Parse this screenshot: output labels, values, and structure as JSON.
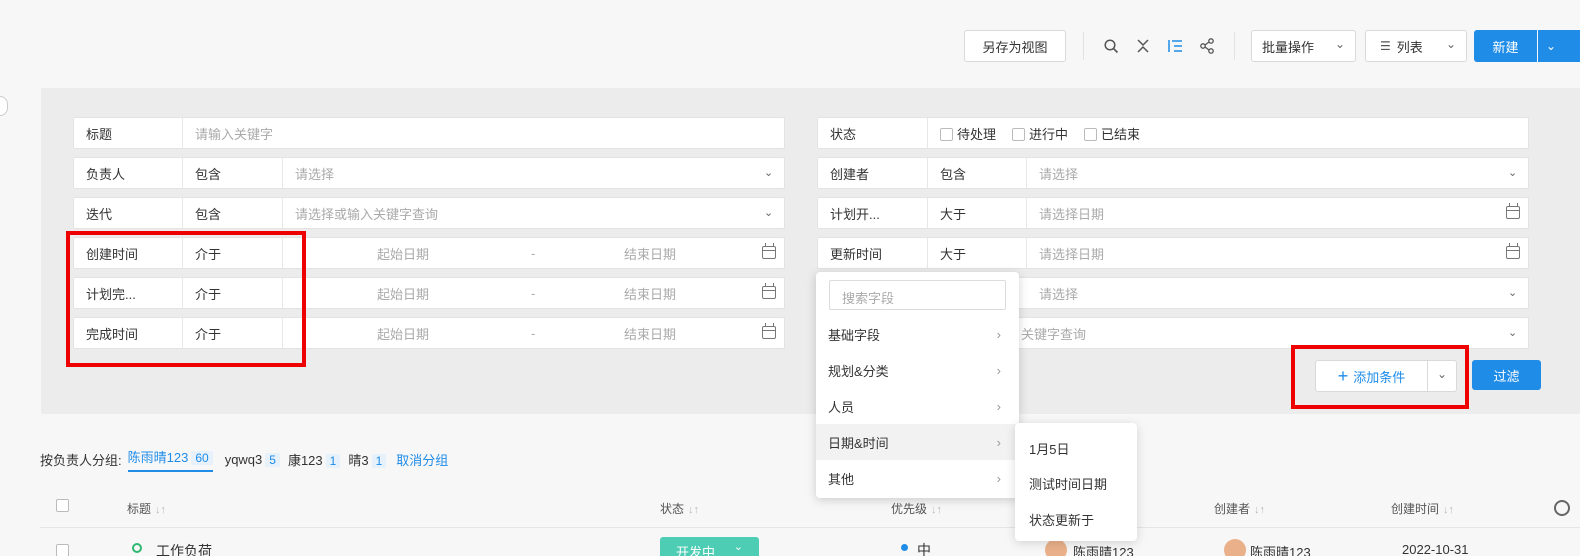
{
  "toolbar": {
    "save_view": "另存为视图",
    "batch": "批量操作",
    "list_view": "列表",
    "new": "新建"
  },
  "filters": {
    "left": [
      {
        "label": "标题",
        "op": "",
        "placeholder": "请输入关键字",
        "type": "text"
      },
      {
        "label": "负责人",
        "op": "包含",
        "placeholder": "请选择",
        "type": "select"
      },
      {
        "label": "迭代",
        "op": "包含",
        "placeholder": "请选择或输入关键字查询",
        "type": "select"
      },
      {
        "label": "创建时间",
        "op": "介于",
        "start": "起始日期",
        "sep": "-",
        "end": "结束日期",
        "type": "range"
      },
      {
        "label": "计划完...",
        "op": "介于",
        "start": "起始日期",
        "sep": "-",
        "end": "结束日期",
        "type": "range"
      },
      {
        "label": "完成时间",
        "op": "介于",
        "start": "起始日期",
        "sep": "-",
        "end": "结束日期",
        "type": "range"
      }
    ],
    "right": [
      {
        "label": "状态",
        "options": [
          "待处理",
          "进行中",
          "已结束"
        ]
      },
      {
        "label": "创建者",
        "op": "包含",
        "placeholder": "请选择"
      },
      {
        "label": "计划开...",
        "op": "大于",
        "placeholder": "请选择日期"
      },
      {
        "label": "更新时间",
        "op": "大于",
        "placeholder": "请选择日期"
      },
      {
        "placeholder": "请选择"
      },
      {
        "placeholder": "关键字查询"
      }
    ],
    "add_condition": "添加条件",
    "filter_button": "过滤"
  },
  "field_menu": {
    "search_placeholder": "搜索字段",
    "items": [
      "基础字段",
      "规划&分类",
      "人员",
      "日期&时间",
      "其他"
    ],
    "submenu": [
      "1月5日",
      "测试时间日期",
      "状态更新于"
    ]
  },
  "group": {
    "label": "按负责人分组:",
    "items": [
      {
        "name": "陈雨晴123",
        "count": "60"
      },
      {
        "name": "yqwq3",
        "count": "5"
      },
      {
        "name": "康123",
        "count": "1"
      },
      {
        "name": "晴3",
        "count": "1"
      }
    ],
    "cancel": "取消分组"
  },
  "table": {
    "headers": [
      "标题",
      "状态",
      "优先级",
      "创建者",
      "创建时间"
    ],
    "row": {
      "title": "工作负荷",
      "status": "开发中",
      "priority": "中",
      "assignee": "陈雨晴123",
      "creator": "陈雨晴123",
      "created": "2022-10-31"
    }
  },
  "colors": {
    "primary": "#1f8ce8",
    "highlight": "#e00000",
    "status_tag": "#4ecdb5"
  }
}
